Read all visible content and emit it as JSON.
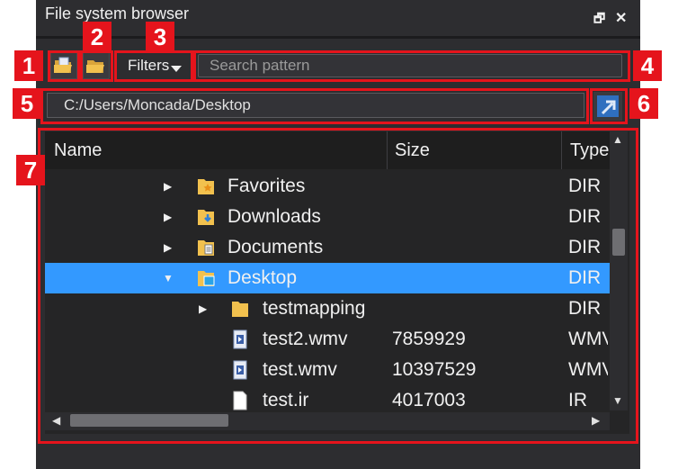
{
  "window": {
    "title": "File system browser",
    "restore_glyph": "🗗",
    "close_glyph": "✕"
  },
  "toolbar": {
    "filters_label": "Filters"
  },
  "search": {
    "placeholder": "Search pattern",
    "value": ""
  },
  "path": {
    "value": "C:/Users/Moncada/Desktop"
  },
  "tree": {
    "columns": [
      {
        "label": "Name"
      },
      {
        "label": "Size"
      },
      {
        "label": "Type"
      }
    ],
    "rows": [
      {
        "name": "Favorites",
        "size": "",
        "type": "DIR",
        "icon": "favorites-folder-icon",
        "expanded": false,
        "selected": false,
        "level": 1
      },
      {
        "name": "Downloads",
        "size": "",
        "type": "DIR",
        "icon": "downloads-folder-icon",
        "expanded": false,
        "selected": false,
        "level": 1
      },
      {
        "name": "Documents",
        "size": "",
        "type": "DIR",
        "icon": "documents-folder-icon",
        "expanded": false,
        "selected": false,
        "level": 1
      },
      {
        "name": "Desktop",
        "size": "",
        "type": "DIR",
        "icon": "desktop-folder-icon",
        "expanded": true,
        "selected": true,
        "level": 1
      },
      {
        "name": "testmapping",
        "size": "",
        "type": "DIR",
        "icon": "folder-icon",
        "expanded": false,
        "selected": false,
        "level": 2
      },
      {
        "name": "test2.wmv",
        "size": "7859929",
        "type": "WMV",
        "icon": "video-file-icon",
        "selected": false,
        "level": 2
      },
      {
        "name": "test.wmv",
        "size": "10397529",
        "type": "WMV",
        "icon": "video-file-icon",
        "selected": false,
        "level": 2
      },
      {
        "name": "test.ir",
        "size": "4017003",
        "type": "IR",
        "icon": "file-icon",
        "selected": false,
        "level": 2
      }
    ]
  },
  "annotations": [
    "1",
    "2",
    "3",
    "4",
    "5",
    "6",
    "7"
  ],
  "colors": {
    "highlight": "#e5141c",
    "selection": "#3399ff",
    "folder": "#f2c14e",
    "panel": "#2d2d30"
  }
}
